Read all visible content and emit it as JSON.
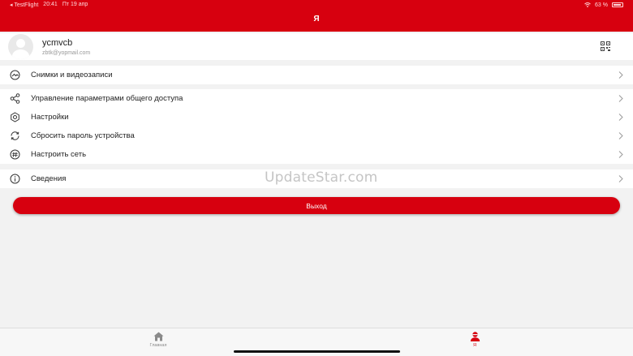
{
  "status_bar": {
    "carrier": "◂ TestFlight",
    "time": "20:41",
    "date": "Пт 19 апр",
    "battery": "63 %"
  },
  "header": {
    "title": "Я"
  },
  "profile": {
    "name": "ycmvcb",
    "email": "zbtk@yopmail.com",
    "qr_icon": "qr-code-icon"
  },
  "menu": {
    "media": {
      "label": "Снимки и видеозаписи",
      "icon": "media-icon"
    },
    "sharing": {
      "label": "Управление параметрами общего доступа",
      "icon": "share-icon"
    },
    "settings": {
      "label": "Настройки",
      "icon": "settings-icon"
    },
    "reset_password": {
      "label": "Сбросить пароль устройства",
      "icon": "refresh-icon"
    },
    "network": {
      "label": "Настроить сеть",
      "icon": "hashtag-icon"
    },
    "info": {
      "label": "Сведения",
      "icon": "info-icon"
    }
  },
  "watermark": "UpdateStar.com",
  "logout_label": "Выход",
  "tabbar": {
    "home_label": "Главная",
    "me_label": "Я"
  },
  "colors": {
    "brand": "#d7000f",
    "background": "#f2f2f2"
  }
}
